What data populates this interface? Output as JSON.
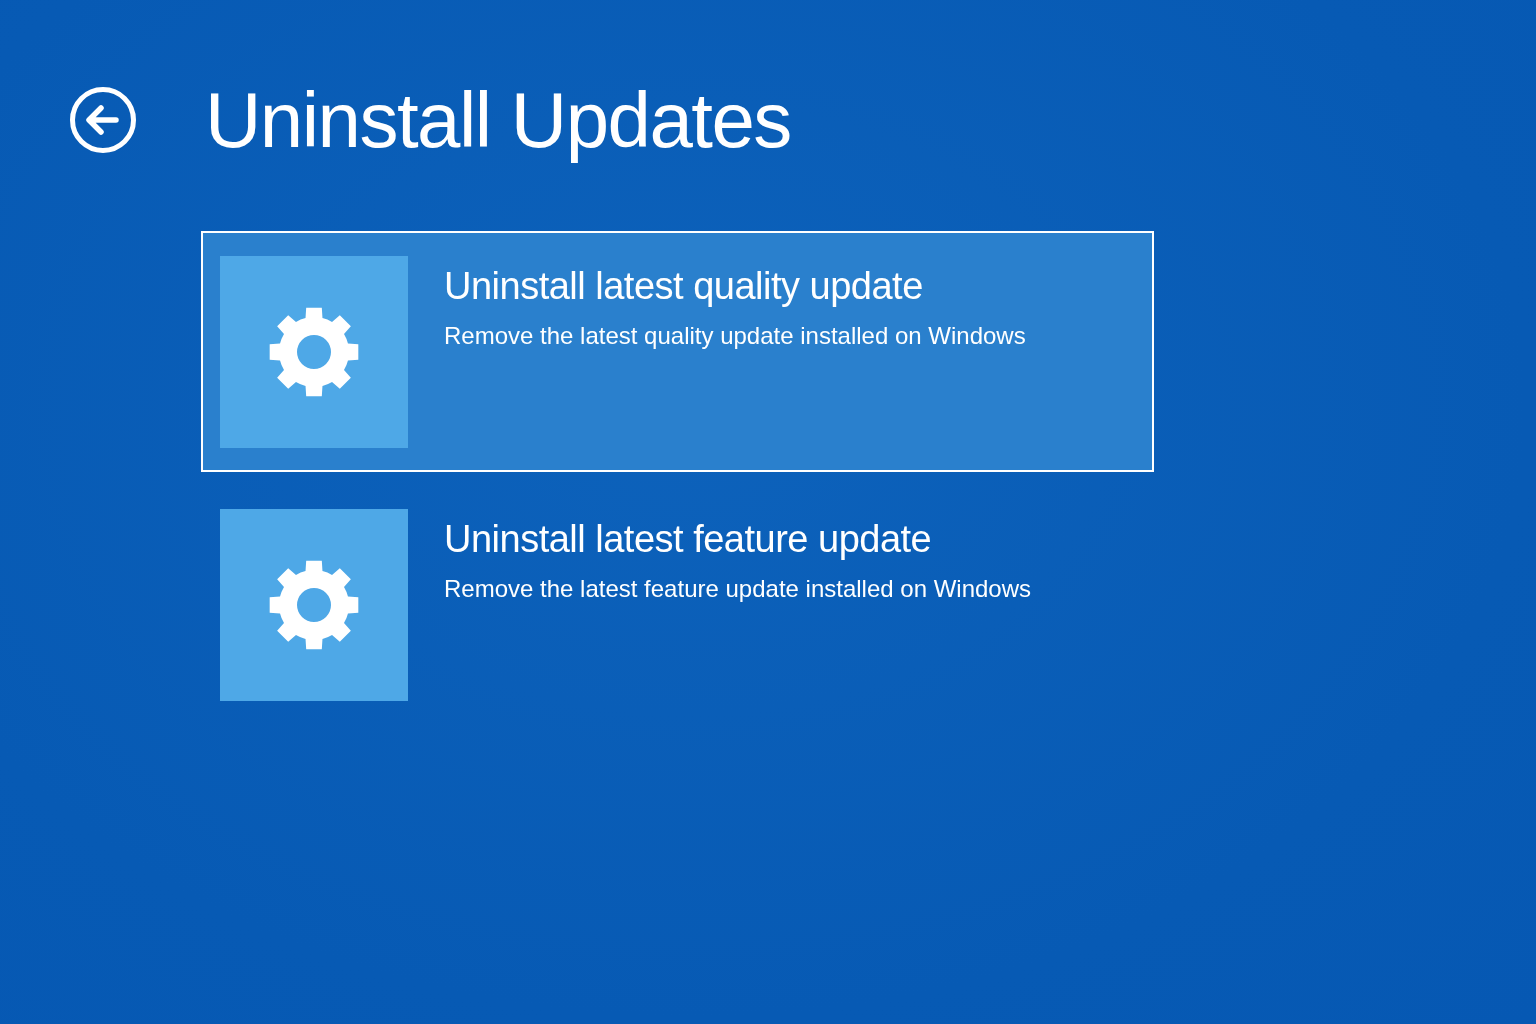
{
  "header": {
    "title": "Uninstall Updates"
  },
  "options": [
    {
      "title": "Uninstall latest quality update",
      "description": "Remove the latest quality update installed on Windows",
      "selected": true
    },
    {
      "title": "Uninstall latest feature update",
      "description": "Remove the latest feature update installed on Windows",
      "selected": false
    }
  ]
}
